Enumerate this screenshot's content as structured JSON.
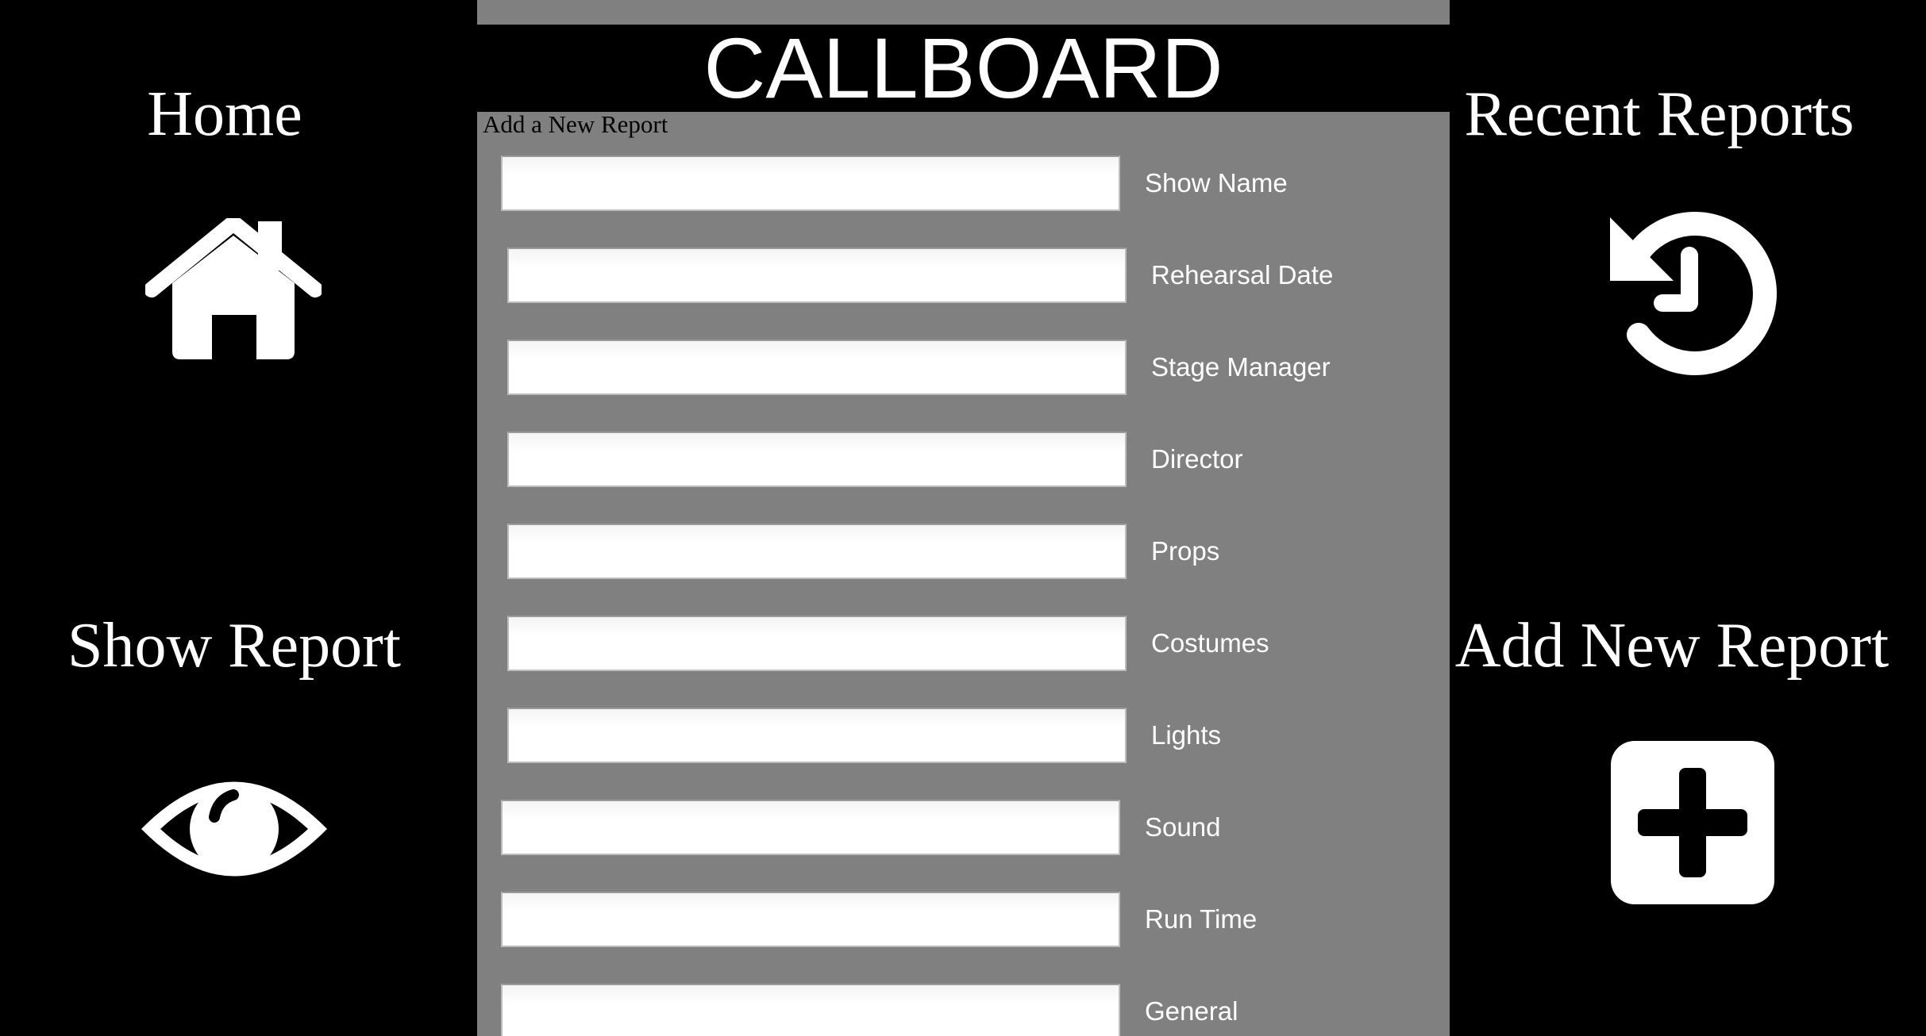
{
  "app": {
    "title": "CALLBOARD"
  },
  "nav": {
    "home_label": "Home",
    "home_icon": "home-icon",
    "recent_label": "Recent Reports",
    "recent_icon": "history-icon",
    "show_label": "Show Report",
    "show_icon": "eye-icon",
    "add_label": "Add New Report",
    "add_icon": "plus-square-icon"
  },
  "form": {
    "heading": "Add a New Report",
    "fields": [
      {
        "label": "Show Name",
        "value": "",
        "placeholder": ""
      },
      {
        "label": "Rehearsal Date",
        "value": "",
        "placeholder": ""
      },
      {
        "label": "Stage Manager",
        "value": "",
        "placeholder": ""
      },
      {
        "label": "Director",
        "value": "",
        "placeholder": ""
      },
      {
        "label": "Props",
        "value": "",
        "placeholder": ""
      },
      {
        "label": "Costumes",
        "value": "",
        "placeholder": ""
      },
      {
        "label": "Lights",
        "value": "",
        "placeholder": ""
      },
      {
        "label": "Sound",
        "value": "",
        "placeholder": ""
      },
      {
        "label": "Run Time",
        "value": "",
        "placeholder": ""
      },
      {
        "label": "General",
        "value": "",
        "placeholder": ""
      }
    ]
  },
  "colors": {
    "background": "#000000",
    "panel": "#808080",
    "text_light": "#ffffff",
    "text_dark": "#000000"
  }
}
